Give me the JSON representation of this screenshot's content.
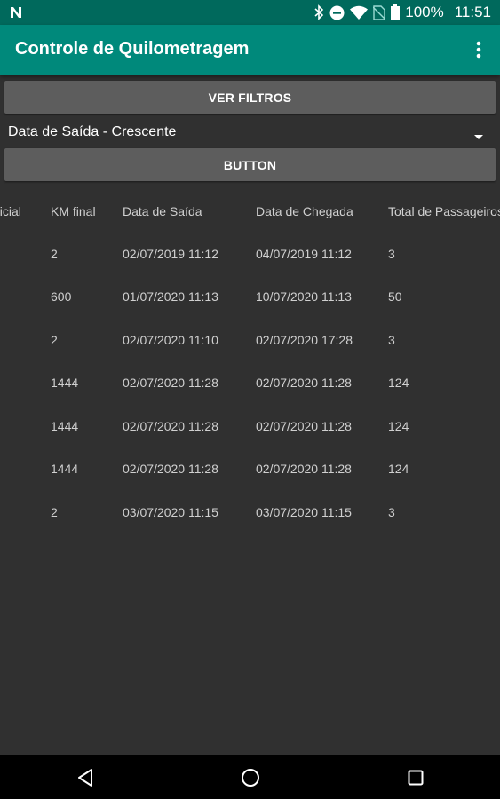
{
  "status_bar": {
    "battery": "100%",
    "time": "11:51"
  },
  "app_bar": {
    "title": "Controle de Quilometragem"
  },
  "buttons": {
    "filters_label": "VER FILTROS",
    "generic_label": "BUTTON"
  },
  "sort_spinner": {
    "selected": "Data de Saída - Crescente"
  },
  "table": {
    "headers": [
      "nicial",
      "KM final",
      "Data de Saída",
      "Data de Chegada",
      "Total de Passageiros"
    ],
    "rows": [
      [
        "",
        "2",
        "02/07/2019 11:12",
        "04/07/2019 11:12",
        "3"
      ],
      [
        "",
        "600",
        "01/07/2020 11:13",
        "10/07/2020 11:13",
        "50"
      ],
      [
        "",
        "2",
        "02/07/2020 11:10",
        "02/07/2020 17:28",
        "3"
      ],
      [
        "",
        "1444",
        "02/07/2020 11:28",
        "02/07/2020 11:28",
        "124"
      ],
      [
        "",
        "1444",
        "02/07/2020 11:28",
        "02/07/2020 11:28",
        "124"
      ],
      [
        "",
        "1444",
        "02/07/2020 11:28",
        "02/07/2020 11:28",
        "124"
      ],
      [
        "",
        "2",
        "03/07/2020 11:15",
        "03/07/2020 11:15",
        "3"
      ]
    ]
  },
  "colors": {
    "status_bar": "#00695c",
    "app_bar": "#00897b",
    "background": "#303030",
    "button": "#5d5d5d"
  }
}
